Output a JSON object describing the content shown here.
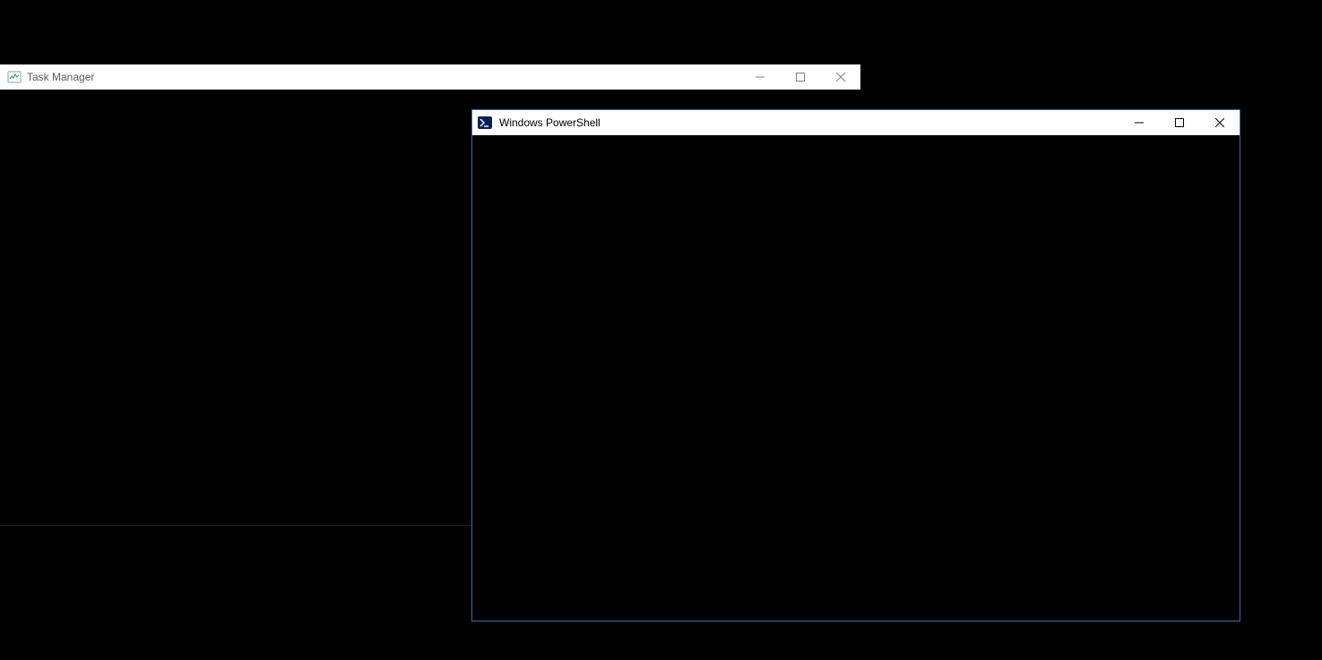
{
  "task_manager": {
    "title": "Task Manager",
    "icon_name": "task-manager-icon"
  },
  "powershell": {
    "title": "Windows PowerShell",
    "icon_name": "powershell-icon"
  },
  "window_controls": {
    "minimize": "Minimize",
    "maximize": "Maximize",
    "close": "Close"
  }
}
